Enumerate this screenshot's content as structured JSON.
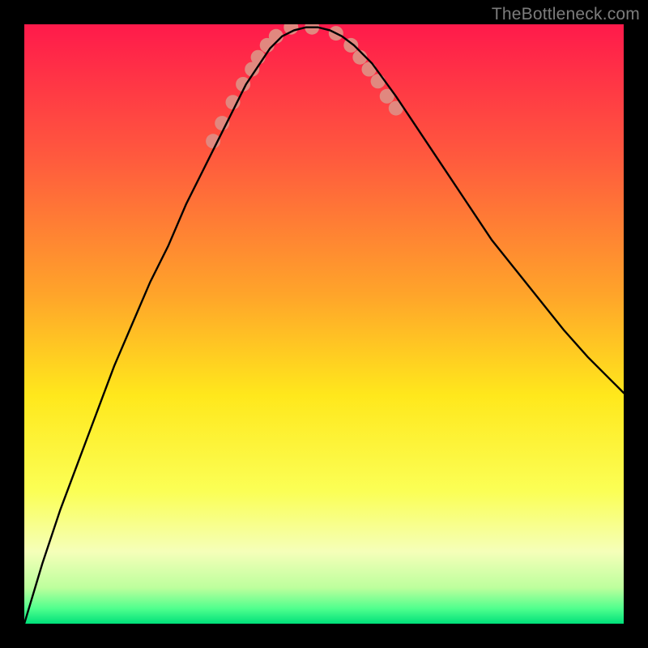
{
  "watermark": "TheBottleneck.com",
  "chart_data": {
    "type": "line",
    "title": "",
    "xlabel": "",
    "ylabel": "",
    "xlim": [
      0,
      100
    ],
    "ylim": [
      0,
      100
    ],
    "grid": false,
    "legend": false,
    "background_gradient": {
      "direction": "vertical",
      "stops": [
        {
          "pos": 0.0,
          "color": "#ff1a4b"
        },
        {
          "pos": 0.22,
          "color": "#ff593e"
        },
        {
          "pos": 0.45,
          "color": "#ffa42a"
        },
        {
          "pos": 0.62,
          "color": "#ffe81c"
        },
        {
          "pos": 0.78,
          "color": "#fbff56"
        },
        {
          "pos": 0.88,
          "color": "#f5ffb9"
        },
        {
          "pos": 0.94,
          "color": "#bdff9d"
        },
        {
          "pos": 0.975,
          "color": "#4fff8d"
        },
        {
          "pos": 1.0,
          "color": "#00e07a"
        }
      ]
    },
    "series": [
      {
        "name": "curve",
        "color": "#000000",
        "stroke_width": 2.4,
        "x": [
          0,
          3,
          6,
          9,
          12,
          15,
          18,
          21,
          24,
          27,
          30,
          33,
          35,
          37,
          39,
          41,
          43,
          45,
          47,
          49,
          51,
          53,
          55,
          58,
          62,
          66,
          70,
          74,
          78,
          82,
          86,
          90,
          94,
          98,
          100
        ],
        "y": [
          0,
          10,
          19,
          27,
          35,
          43,
          50,
          57,
          63,
          70,
          76,
          82,
          86,
          90,
          93,
          96,
          98,
          99,
          99.5,
          99.5,
          99,
          98,
          96.5,
          93.5,
          88,
          82,
          76,
          70,
          64,
          59,
          54,
          49,
          44.5,
          40.5,
          38.5
        ]
      }
    ],
    "markers": {
      "name": "pink-dots",
      "color": "#e1887f",
      "radius": 9,
      "points_xy": [
        [
          31.5,
          80.5
        ],
        [
          33.0,
          83.5
        ],
        [
          34.8,
          87.0
        ],
        [
          36.5,
          90.0
        ],
        [
          38.0,
          92.5
        ],
        [
          39.0,
          94.5
        ],
        [
          40.5,
          96.5
        ],
        [
          42.0,
          98.0
        ],
        [
          44.5,
          99.5
        ],
        [
          48.0,
          99.5
        ],
        [
          52.0,
          98.5
        ],
        [
          54.5,
          96.5
        ],
        [
          56.0,
          94.5
        ],
        [
          57.5,
          92.5
        ],
        [
          59.0,
          90.5
        ],
        [
          60.5,
          88.0
        ],
        [
          62.0,
          86.0
        ]
      ]
    }
  }
}
